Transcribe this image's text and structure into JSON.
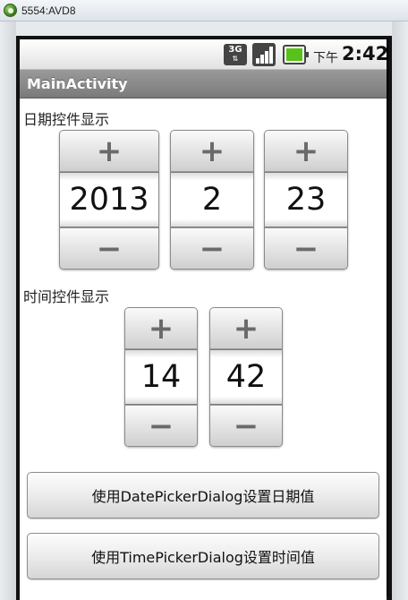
{
  "window": {
    "title": "5554:AVD8",
    "icon": "android-emulator-icon"
  },
  "status_bar": {
    "network_label": "3G",
    "ampm": "下午",
    "time": "2:42",
    "icons": [
      "network-3g-icon",
      "signal-strength-icon",
      "battery-charging-icon"
    ]
  },
  "app": {
    "title": "MainActivity"
  },
  "date_section": {
    "label": "日期控件显示",
    "pickers": [
      {
        "name": "year",
        "value": "2013",
        "inc": "+",
        "dec": "−"
      },
      {
        "name": "month",
        "value": "2",
        "inc": "+",
        "dec": "−"
      },
      {
        "name": "day",
        "value": "23",
        "inc": "+",
        "dec": "−"
      }
    ]
  },
  "time_section": {
    "label": "时间控件显示",
    "pickers": [
      {
        "name": "hour",
        "value": "14",
        "inc": "+",
        "dec": "−"
      },
      {
        "name": "minute",
        "value": "42",
        "inc": "+",
        "dec": "−"
      }
    ]
  },
  "buttons": {
    "date_dialog": "使用DatePickerDialog设置日期值",
    "time_dialog": "使用TimePickerDialog设置时间值"
  }
}
